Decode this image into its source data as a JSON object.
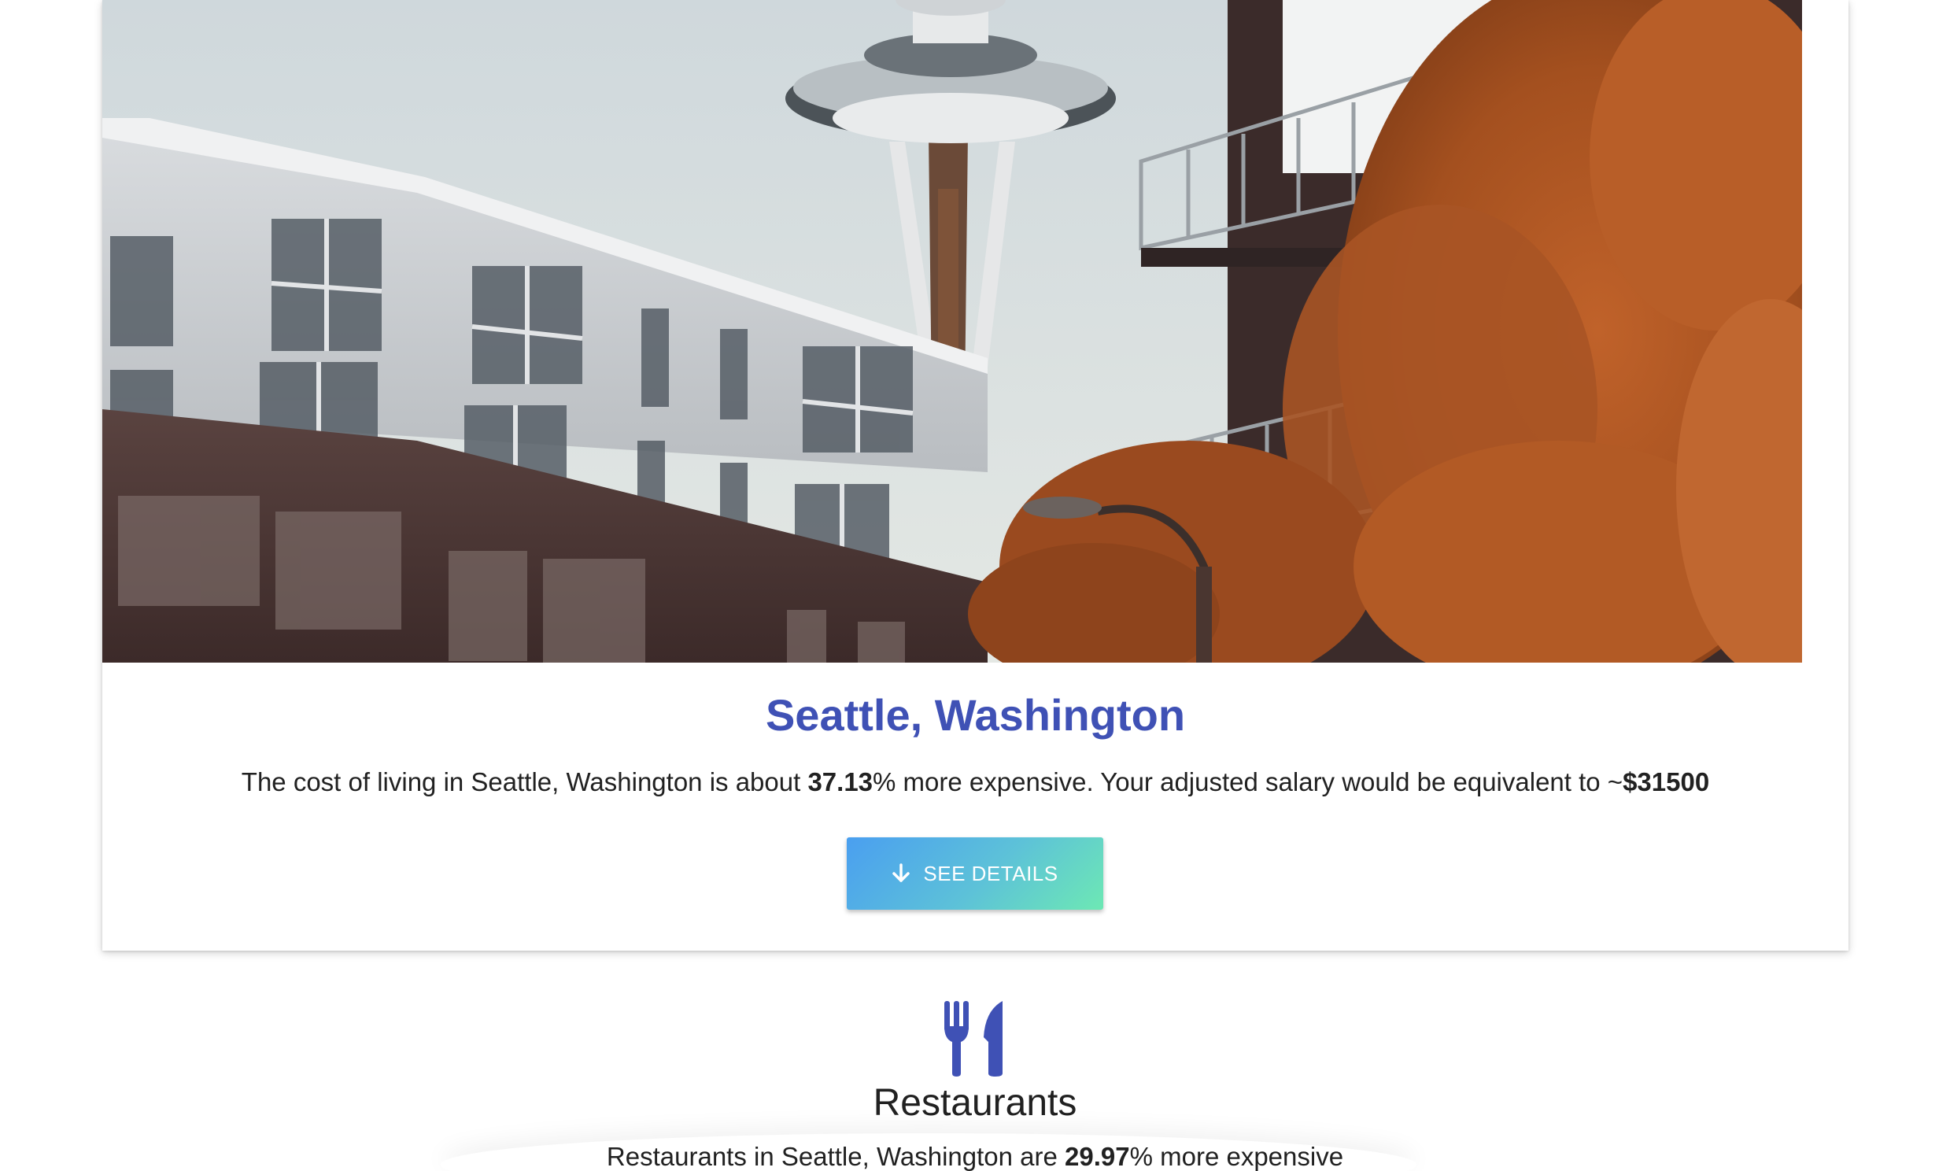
{
  "city_card": {
    "image_alt": "Seattle Space Needle with autumn trees",
    "title": "Seattle, Washington",
    "summary_prefix": "The cost of living in Seattle, Washington is about ",
    "percent": "37.13",
    "summary_middle": "% more expensive. Your adjusted salary would be equivalent to ~",
    "salary": "$31500",
    "details_button": "SEE DETAILS"
  },
  "restaurants": {
    "title": "Restaurants",
    "text_prefix": "Restaurants in Seattle, Washington are ",
    "percent": "29.97",
    "text_suffix": "% more expensive"
  },
  "colors": {
    "accent": "#3f51b5",
    "button_gradient_start": "#4a9ff0",
    "button_gradient_end": "#6de8b4"
  },
  "icons": {
    "details": "arrow-down-icon",
    "restaurants": "fork-knife-icon"
  }
}
